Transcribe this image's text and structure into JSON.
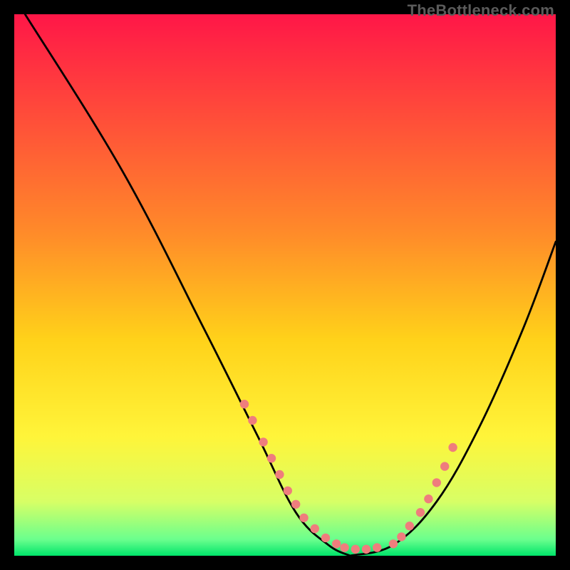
{
  "watermark": "TheBottleneck.com",
  "chart_data": {
    "type": "line",
    "title": "",
    "xlabel": "",
    "ylabel": "",
    "xlim": [
      0,
      100
    ],
    "ylim": [
      0,
      100
    ],
    "grid": false,
    "gradient_stops": [
      {
        "offset": 0.0,
        "color": "#ff1748"
      },
      {
        "offset": 0.4,
        "color": "#ff8a2a"
      },
      {
        "offset": 0.6,
        "color": "#ffd21a"
      },
      {
        "offset": 0.78,
        "color": "#fff53a"
      },
      {
        "offset": 0.9,
        "color": "#d8ff66"
      },
      {
        "offset": 0.97,
        "color": "#6bff8e"
      },
      {
        "offset": 1.0,
        "color": "#00e56a"
      }
    ],
    "series": [
      {
        "name": "left-branch",
        "color": "#000000",
        "x": [
          2,
          20,
          35,
          45,
          52,
          58,
          62
        ],
        "y": [
          100,
          71,
          42,
          22,
          8,
          2,
          0
        ]
      },
      {
        "name": "right-branch",
        "color": "#000000",
        "x": [
          62,
          70,
          78,
          86,
          94,
          100
        ],
        "y": [
          0,
          2,
          10,
          24,
          42,
          58
        ]
      }
    ],
    "highlight_regions": [
      {
        "name": "left-dots",
        "color": "#ef7d7d",
        "x": [
          42.5,
          44.0,
          46.0,
          47.5,
          49.0,
          50.5,
          52.0,
          53.5,
          55.5,
          57.5,
          59.5,
          61.0,
          63.0,
          65.0,
          67.0
        ],
        "y": [
          28.0,
          25.0,
          21.0,
          18.0,
          15.0,
          12.0,
          9.5,
          7.0,
          5.0,
          3.3,
          2.2,
          1.5,
          1.2,
          1.2,
          1.5
        ]
      },
      {
        "name": "right-dots",
        "color": "#ef7d7d",
        "x": [
          70.0,
          71.5,
          73.0,
          75.0,
          76.5,
          78.0,
          79.5,
          81.0
        ],
        "y": [
          2.2,
          3.5,
          5.5,
          8.0,
          10.5,
          13.5,
          16.5,
          20.0
        ]
      }
    ]
  }
}
